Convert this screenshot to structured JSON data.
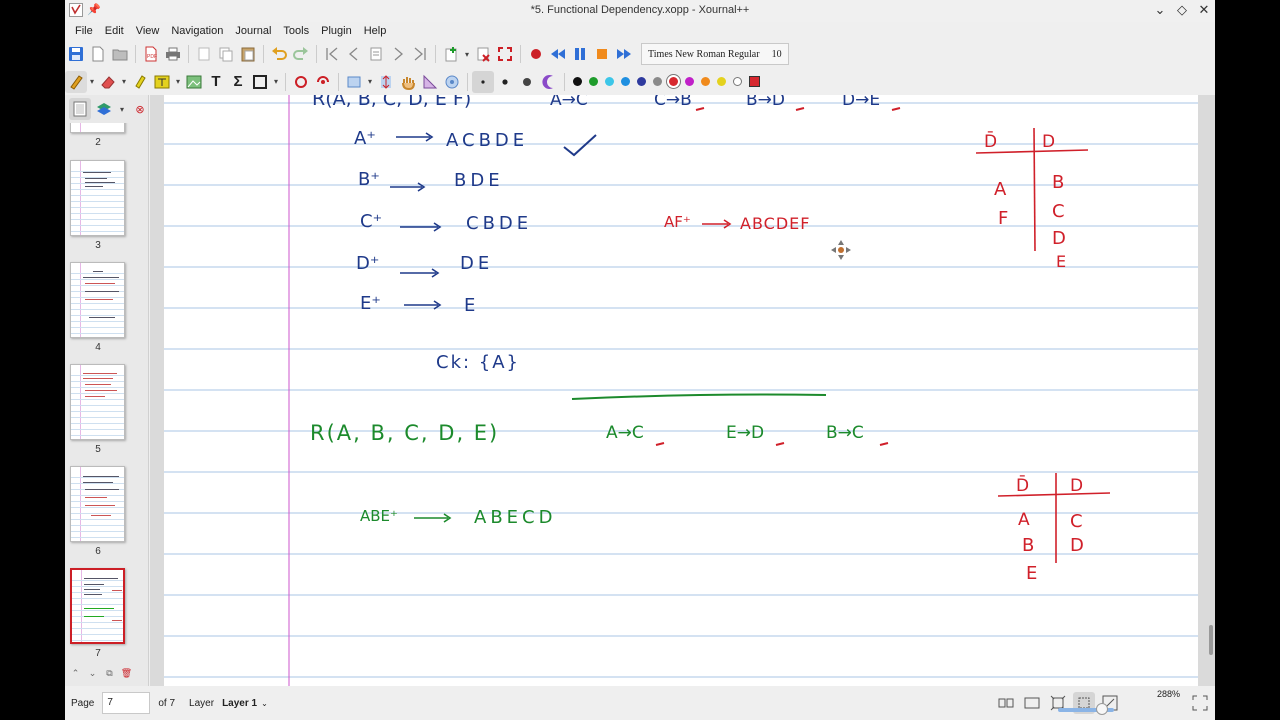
{
  "window": {
    "title": "*5. Functional Dependency.xopp - Xournal++",
    "buttons": [
      "minimize-icon",
      "maximize-icon",
      "close-icon"
    ]
  },
  "menu": [
    "File",
    "Edit",
    "View",
    "Navigation",
    "Journal",
    "Tools",
    "Plugin",
    "Help"
  ],
  "toolbar": {
    "font_name": "Times New Roman Regular",
    "font_size": "10",
    "colors": [
      "#111111",
      "#1e9c2b",
      "#3cc6e8",
      "#1f8fe0",
      "#2e3a9e",
      "#8a8a8a",
      "#d7282f",
      "#c020c8",
      "#f08a1c",
      "#e4d21e",
      "#ffffff"
    ],
    "selected_color": "#d7282f",
    "accent": "#cc1f26"
  },
  "sidebar": {
    "pages": [
      {
        "number": "2"
      },
      {
        "number": "3"
      },
      {
        "number": "4"
      },
      {
        "number": "5"
      },
      {
        "number": "6"
      },
      {
        "number": "7",
        "active": true
      }
    ]
  },
  "canvas": {
    "ink_blue": "#1f3a8a",
    "ink_red": "#d0202a",
    "ink_green": "#1c8a2c",
    "section1": {
      "relation": "R(A, B, C, D, E F)",
      "fds": [
        "A→C",
        "C→B",
        "B→D",
        "D→E"
      ],
      "closures": [
        {
          "attr": "A⁺",
          "result": "ACBDE"
        },
        {
          "attr": "B⁺",
          "result": "BDE"
        },
        {
          "attr": "C⁺",
          "result": "CBDE"
        },
        {
          "attr": "D⁺",
          "result": "DE"
        },
        {
          "attr": "E⁺",
          "result": "E"
        }
      ],
      "candidate_key": "Ck: {A}",
      "af_closure_attr": "AF⁺",
      "af_closure_result": "ABCDEF",
      "table_header_left": "D̄",
      "table_header_right": "D",
      "table_left": [
        "A",
        "F"
      ],
      "table_right": [
        "B",
        "C",
        "D",
        "E"
      ]
    },
    "section2": {
      "relation": "R(A, B, C, D, E)",
      "fds": [
        "A→C",
        "E→D",
        "B→C"
      ],
      "closure_attr": "ABE⁺",
      "closure_result": "ABECD",
      "table_header_left": "D̄",
      "table_header_right": "D",
      "table_left": [
        "A",
        "B",
        "E"
      ],
      "table_right": [
        "C",
        "D"
      ]
    }
  },
  "status": {
    "page_label": "Page",
    "page_value": "7",
    "page_of": "of 7",
    "layer_label": "Layer",
    "layer_value": "Layer 1",
    "zoom": "288%"
  }
}
